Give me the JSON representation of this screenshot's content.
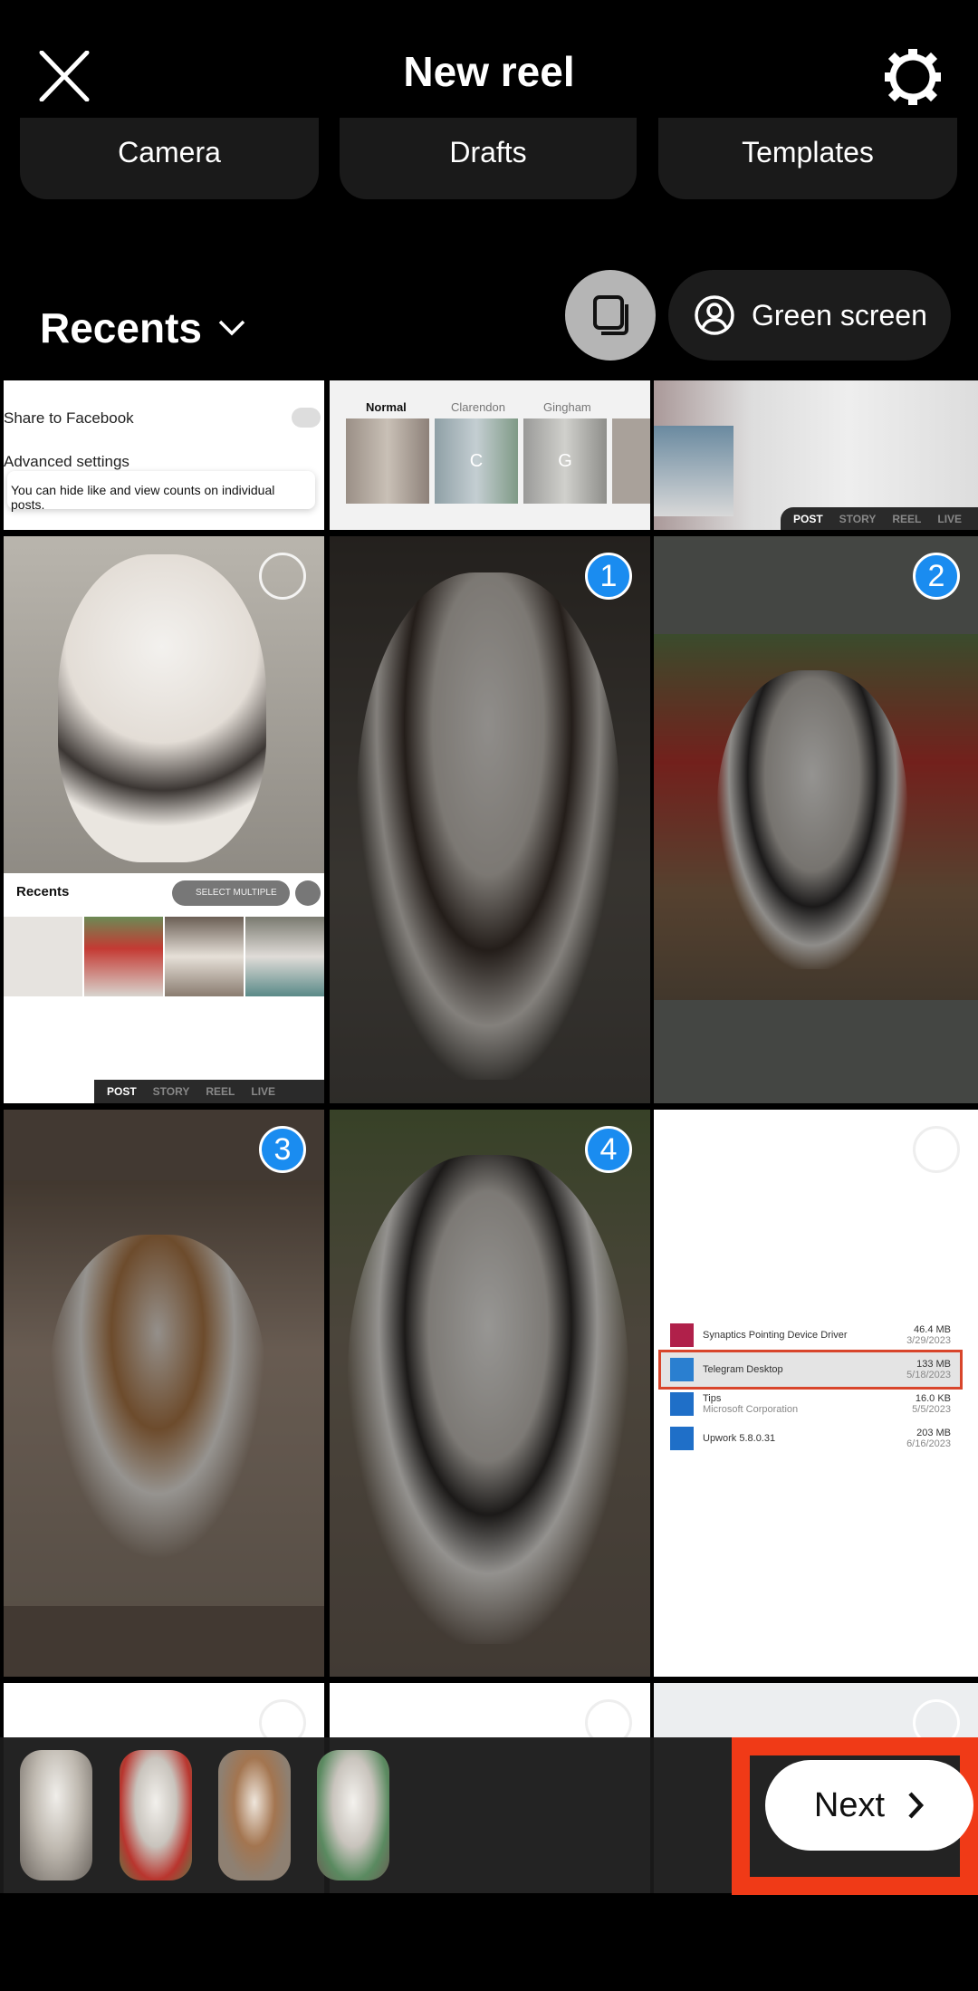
{
  "header": {
    "title": "New reel",
    "close_icon": "close-icon",
    "settings_icon": "gear-icon"
  },
  "modes": [
    "Camera",
    "Drafts",
    "Templates"
  ],
  "gallery": {
    "album": "Recents",
    "green_screen": "Green screen"
  },
  "colors": {
    "selection_badge": "#1a8cf0",
    "highlight": "#f03a17",
    "next_bg": "#ffffff"
  },
  "cells": {
    "c1": {
      "share_to_facebook": "Share to Facebook",
      "advanced_settings": "Advanced settings",
      "tooltip": "You can hide like and view counts on individual posts."
    },
    "c2": {
      "filters": [
        "Normal",
        "Clarendon",
        "Gingham"
      ],
      "letters": [
        "C",
        "G"
      ]
    },
    "c3": {
      "modes": [
        "POST",
        "STORY",
        "REEL",
        "LIVE"
      ]
    },
    "c4": {
      "album": "Recents",
      "select_multiple": "SELECT MULTIPLE",
      "modes": [
        "POST",
        "STORY",
        "REEL",
        "LIVE"
      ]
    },
    "apps": [
      {
        "name": "Synaptics Pointing Device Driver",
        "sub": "",
        "size": "46.4 MB",
        "date": "3/29/2023",
        "color": "#b0204a"
      },
      {
        "name": "Telegram Desktop",
        "sub": "",
        "size": "133 MB",
        "date": "5/18/2023",
        "color": "#2a7fd0"
      },
      {
        "name": "Tips",
        "sub": "Microsoft Corporation",
        "size": "16.0 KB",
        "date": "5/5/2023",
        "color": "#1f6fc8"
      },
      {
        "name": "Upwork 5.8.0.31",
        "sub": "",
        "size": "203 MB",
        "date": "6/16/2023",
        "color": "#1f6fc8"
      }
    ]
  },
  "selection": [
    "1",
    "2",
    "3",
    "4"
  ],
  "next_label": "Next"
}
